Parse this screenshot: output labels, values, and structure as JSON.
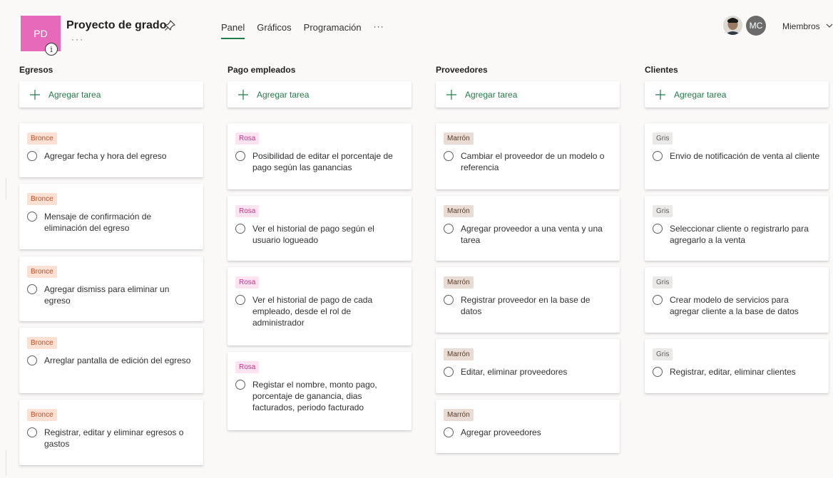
{
  "plan": {
    "initials": "PD",
    "title": "Proyecto de grado",
    "info": "i",
    "more": "···"
  },
  "tabs": [
    {
      "label": "Panel",
      "active": true
    },
    {
      "label": "Gráficos"
    },
    {
      "label": "Programación"
    }
  ],
  "tabs_more": "···",
  "members": {
    "avatar_initials": "MC",
    "label": "Miembros"
  },
  "add_task_label": "Agregar tarea",
  "colors": {
    "accent": "#237b4b",
    "plan_tile": "#e66ab9"
  },
  "buckets": [
    {
      "name": "Egresos",
      "tasks": [
        {
          "label": "Bronce",
          "title": "Agregar fecha y hora del egreso"
        },
        {
          "label": "Bronce",
          "title": "Mensaje de confirmación de eliminación del egreso"
        },
        {
          "label": "Bronce",
          "title": "Agregar dismiss para eliminar un egreso"
        },
        {
          "label": "Bronce",
          "title": "Arreglar pantalla de edición del egreso"
        },
        {
          "label": "Bronce",
          "title": "Registrar, editar y eliminar egresos o gastos"
        }
      ]
    },
    {
      "name": "Pago empleados",
      "tasks": [
        {
          "label": "Rosa",
          "title": "Posibilidad de editar el porcentaje de pago según las ganancias"
        },
        {
          "label": "Rosa",
          "title": "Ver el historial de pago según el usuario logueado"
        },
        {
          "label": "Rosa",
          "title": "Ver el historial de pago de cada empleado, desde el rol de administrador"
        },
        {
          "label": "Rosa",
          "title": "Registar el nombre, monto pago, porcentaje de ganancia, dias facturados, periodo facturado"
        }
      ]
    },
    {
      "name": "Proveedores",
      "tasks": [
        {
          "label": "Marrón",
          "title": "Cambiar el proveedor de un modelo o referencia"
        },
        {
          "label": "Marrón",
          "title": "Agregar proveedor a una venta y una tarea"
        },
        {
          "label": "Marrón",
          "title": "Registrar proveedor en la base de datos"
        },
        {
          "label": "Marrón",
          "title": "Editar, eliminar proveedores"
        },
        {
          "label": "Marrón",
          "title": "Agregar proveedores"
        }
      ]
    },
    {
      "name": "Clientes",
      "tasks": [
        {
          "label": "Gris",
          "title": "Envio de notificación de venta al cliente"
        },
        {
          "label": "Gris",
          "title": "Seleccionar cliente o registrarlo para agregarlo a la venta"
        },
        {
          "label": "Gris",
          "title": "Crear modelo de servicios para agregar cliente a la base de datos"
        },
        {
          "label": "Gris",
          "title": "Registrar, editar, eliminar clientes"
        }
      ]
    }
  ]
}
